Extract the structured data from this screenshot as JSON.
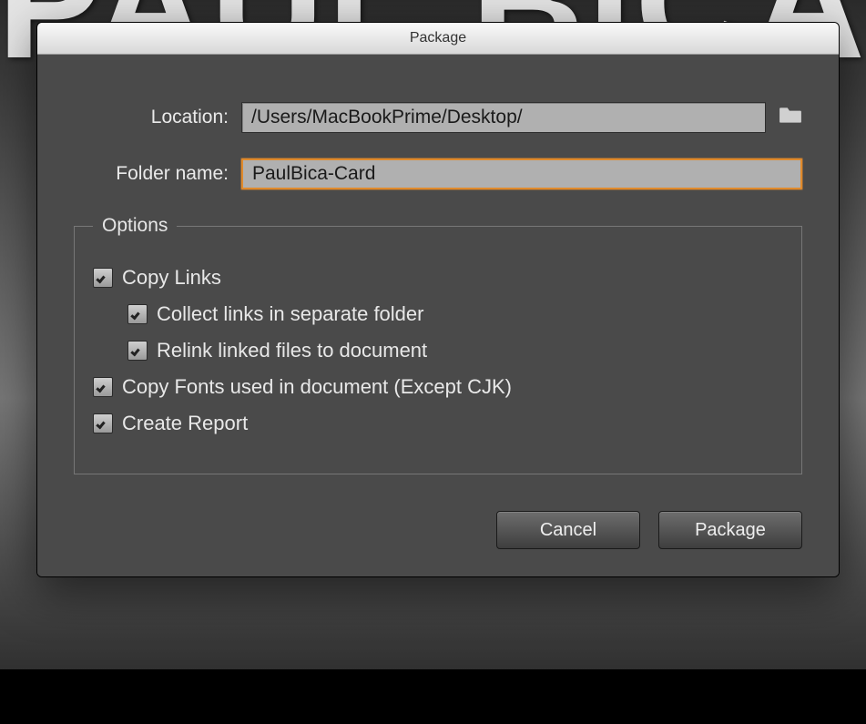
{
  "dialog": {
    "title": "Package",
    "location_label": "Location:",
    "location_value": "/Users/MacBookPrime/Desktop/",
    "folder_name_label": "Folder name:",
    "folder_name_value": "PaulBica-Card",
    "options_legend": "Options",
    "options": {
      "copy_links": {
        "label": "Copy Links",
        "checked": true
      },
      "collect_links": {
        "label": "Collect links in separate folder",
        "checked": true
      },
      "relink_files": {
        "label": "Relink linked files to document",
        "checked": true
      },
      "copy_fonts": {
        "label": "Copy Fonts used in document (Except CJK)",
        "checked": true
      },
      "create_report": {
        "label": "Create Report",
        "checked": true
      }
    },
    "buttons": {
      "cancel": "Cancel",
      "package": "Package"
    }
  },
  "background": {
    "big_text": "PAUL BICA"
  }
}
